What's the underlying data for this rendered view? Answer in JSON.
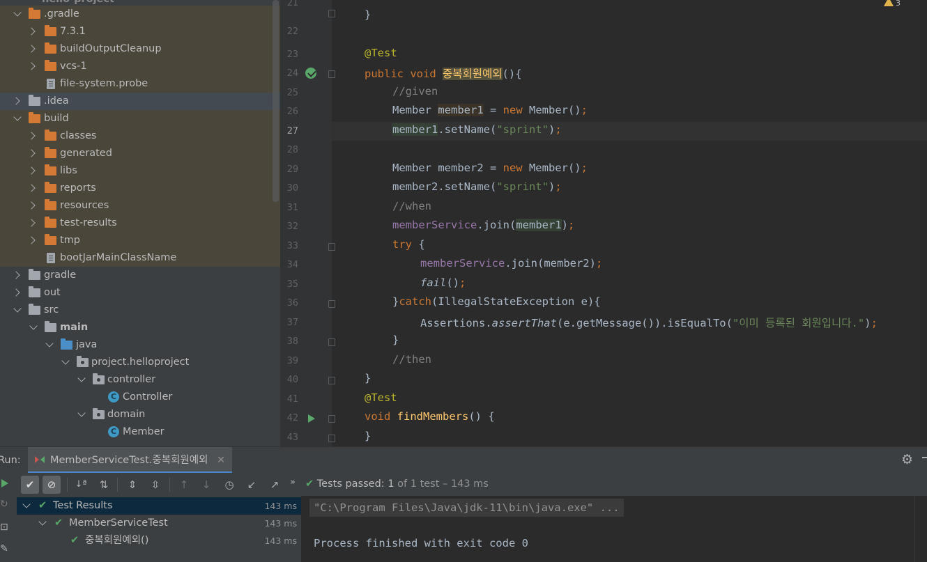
{
  "project_tree": {
    "header_cut": "hello-project",
    "items": [
      {
        "label": ".gradle"
      },
      {
        "label": "7.3.1"
      },
      {
        "label": "buildOutputCleanup"
      },
      {
        "label": "vcs-1"
      },
      {
        "label": "file-system.probe"
      },
      {
        "label": ".idea"
      },
      {
        "label": "build"
      },
      {
        "label": "classes"
      },
      {
        "label": "generated"
      },
      {
        "label": "libs"
      },
      {
        "label": "reports"
      },
      {
        "label": "resources"
      },
      {
        "label": "test-results"
      },
      {
        "label": "tmp"
      },
      {
        "label": "bootJarMainClassName"
      },
      {
        "label": "gradle"
      },
      {
        "label": "out"
      },
      {
        "label": "src"
      },
      {
        "label": "main"
      },
      {
        "label": "java"
      },
      {
        "label": "project.helloproject"
      },
      {
        "label": "controller"
      },
      {
        "label": "Controller"
      },
      {
        "label": "domain"
      },
      {
        "label": "Member"
      }
    ]
  },
  "editor": {
    "line_numbers": [
      "21",
      "22",
      "23",
      "24",
      "25",
      "26",
      "27",
      "28",
      "29",
      "30",
      "31",
      "32",
      "33",
      "34",
      "35",
      "36",
      "37",
      "38",
      "39",
      "40",
      "41",
      "42",
      "43"
    ],
    "warning_count": "3",
    "code": {
      "l21": "}",
      "l23": "@Test",
      "l24_kw": "public void ",
      "l24_name": "중복회원예외",
      "l24_rest": "(){",
      "l25": "//given",
      "l26_a": "Member ",
      "l26_b": "member1",
      "l26_c": " = ",
      "l26_new": "new",
      "l26_d": " Member()",
      "l26_semi": ";",
      "l27_a": "member1",
      "l27_b": ".setName(",
      "l27_str": "\"sprint\"",
      "l27_c": ")",
      "l27_semi": ";",
      "l29_a": "Member member2 = ",
      "l29_new": "new",
      "l29_b": " Member()",
      "l29_semi": ";",
      "l30_a": "member2.setName(",
      "l30_str": "\"sprint\"",
      "l30_b": ")",
      "l30_semi": ";",
      "l31": "//when",
      "l32_fld": "memberService",
      "l32_a": ".join(",
      "l32_ref": "member1",
      "l32_b": ")",
      "l32_semi": ";",
      "l33_kw": "try",
      "l33_b": " {",
      "l34_fld": "memberService",
      "l34_a": ".join(member2)",
      "l34_semi": ";",
      "l35_it": "fail",
      "l35_a": "()",
      "l35_semi": ";",
      "l36_a": "}",
      "l36_kw": "catch",
      "l36_b": "(IllegalStateException e){",
      "l37_a": "Assertions.",
      "l37_it": "assertThat",
      "l37_b": "(e.getMessage()).isEqualTo(",
      "l37_str": "\"이미 등록된 회원입니다.\"",
      "l37_c": ")",
      "l37_semi": ";",
      "l38": "}",
      "l39": "//then",
      "l40": "}",
      "l41": "@Test",
      "l42_kw": "void ",
      "l42_fn": "findMembers",
      "l42_b": "() {",
      "l43": "}"
    }
  },
  "run_panel": {
    "run_label": "Run:",
    "tab_label": "MemberServiceTest.중복회원예외",
    "status_prefix": "Tests passed:",
    "status_count": "1",
    "status_suffix": "of 1 test – 143 ms",
    "tests": [
      {
        "label": "Test Results",
        "time": "143 ms"
      },
      {
        "label": "MemberServiceTest",
        "time": "143 ms"
      },
      {
        "label": "중복회원예외()",
        "time": "143 ms"
      }
    ],
    "console": {
      "line1": "\"C:\\Program Files\\Java\\jdk-11\\bin\\java.exe\" ...",
      "line2": "Process finished with exit code 0"
    }
  }
}
